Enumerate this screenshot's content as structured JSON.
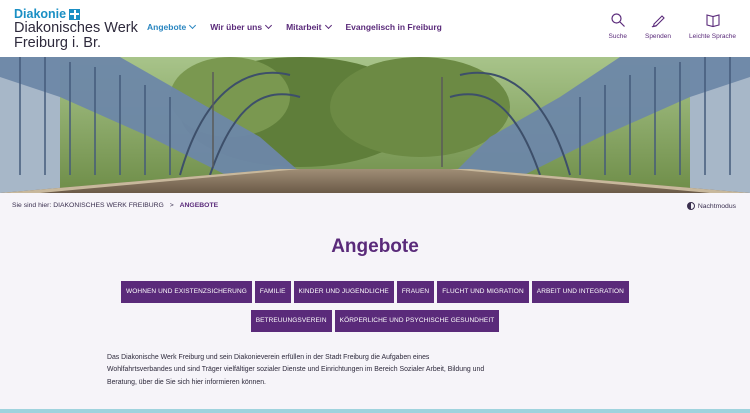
{
  "logo": {
    "brand": "Diakonie",
    "line1": "Diakonisches Werk",
    "line2": "Freiburg i. Br."
  },
  "nav": {
    "items": [
      {
        "label": "Angebote",
        "has_dropdown": true,
        "active": true
      },
      {
        "label": "Wir über uns",
        "has_dropdown": true,
        "active": false
      },
      {
        "label": "Mitarbeit",
        "has_dropdown": true,
        "active": false
      },
      {
        "label": "Evangelisch in Freiburg",
        "has_dropdown": false,
        "active": false
      }
    ]
  },
  "tools": [
    {
      "label": "Suche",
      "icon": "search-icon"
    },
    {
      "label": "Spenden",
      "icon": "pen-icon"
    },
    {
      "label": "Leichte Sprache",
      "icon": "book-icon"
    }
  ],
  "breadcrumb": {
    "prefix": "Sie sind hier:",
    "home": "DIAKONISCHES WERK FREIBURG",
    "separator": ">",
    "current": "ANGEBOTE"
  },
  "night_mode": {
    "label": "Nachtmodus"
  },
  "page_title": "Angebote",
  "categories": {
    "row1": [
      "WOHNEN UND EXISTENZSICHERUNG",
      "FAMILIE",
      "KINDER UND JUGENDLICHE",
      "FRAUEN",
      "FLUCHT UND MIGRATION",
      "ARBEIT UND INTEGRATION"
    ],
    "row2": [
      "BETREUUNGSVEREIN",
      "KÖRPERLICHE UND PSYCHISCHE GESUNDHEIT"
    ]
  },
  "intro_text": "Das Diakonische Werk Freiburg und sein Diakonieverein erfüllen in der Stadt Freiburg die Aufgaben eines Wohlfahrtsverbandes und sind Träger vielfältiger sozialer Dienste und Einrichtungen im Bereich Sozialer Arbeit, Bildung und Beratung, über die Sie sich hier informieren können.",
  "colors": {
    "brand_blue": "#1a8fc4",
    "primary_purple": "#5a2a7a",
    "active_nav": "#2a86c0",
    "background": "#f6f4f9",
    "bottom_accent": "#9fd3de"
  }
}
